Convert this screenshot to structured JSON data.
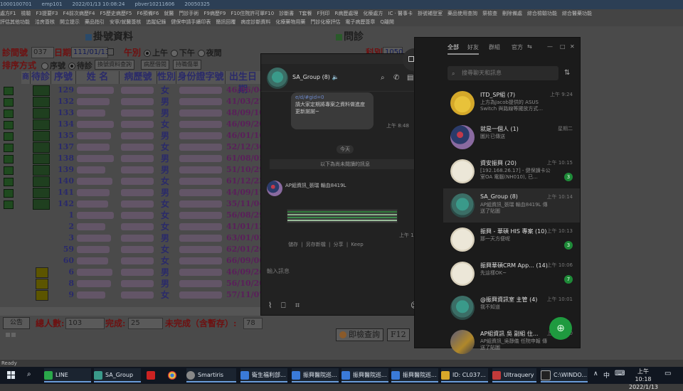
{
  "his": {
    "status_bar": [
      "1000100701",
      "emp101",
      "2022/01/13 10:08:24",
      "pbver10211606",
      "20050325"
    ],
    "menu_row1": [
      "處方F1",
      "檢驗",
      "F3提要F3",
      "F4前次病歷F4",
      "F5歷史病歷F5",
      "F6預備F6",
      "就醫",
      "門診手術",
      "F9病歷F9",
      "F10住院許可單F10",
      "診斷書",
      "T套餐",
      "F列印",
      "R病歷處理",
      "化療處方",
      "IC · 醫事卡",
      "掛號補登室",
      "藥品使用查詢",
      "祭檢查",
      "刪除備處",
      "綜合檢驗功能",
      "綜合醫藥功能"
    ],
    "menu_row2": [
      "評估其他功能",
      "洽房簽核",
      "開立提示",
      "藥品指引",
      "安寧/就醫簽核",
      "追蹤紀錄",
      "健保申請手續印表",
      "簡訊回覆",
      "病症診斷資料",
      "化療藥物用藥",
      "門診化療評估",
      "電子病歷簽章",
      "Q離開"
    ],
    "panel_title": "掛號資料",
    "panel_title2": "問診",
    "clinic_label": "診間號",
    "clinic_value": "037",
    "date_label": "日期",
    "date_value": "111/01/13",
    "shift_label": "午別",
    "shift_options": [
      "上午",
      "下午",
      "夜間"
    ],
    "sort_label": "排序方式",
    "sort_options": [
      "序號",
      "待診"
    ],
    "btn_search_patient": "換號資料查詢",
    "btn_history": "病歷借閱",
    "btn_ward": "持職傷單",
    "right_label_1": "科別",
    "right_value_1": "1050",
    "columns": [
      "商",
      "待診",
      "序號",
      "姓 名",
      "病歷號",
      "性別",
      "身份證字號",
      "出生日期"
    ],
    "rows": [
      {
        "no": "129",
        "sex": "女",
        "birth": "46/06/04",
        "status": "green"
      },
      {
        "no": "132",
        "sex": "男",
        "birth": "41/03/27",
        "status": "green"
      },
      {
        "no": "133",
        "sex": "男",
        "birth": "48/09/10",
        "status": "green"
      },
      {
        "no": "134",
        "sex": "女",
        "birth": "46/09/20",
        "status": "green"
      },
      {
        "no": "135",
        "sex": "男",
        "birth": "46/01/16",
        "status": "green"
      },
      {
        "no": "137",
        "sex": "女",
        "birth": "52/12/30",
        "status": "green"
      },
      {
        "no": "138",
        "sex": "男",
        "birth": "61/08/05",
        "status": "green"
      },
      {
        "no": "139",
        "sex": "男",
        "birth": "51/10/29",
        "status": "green"
      },
      {
        "no": "140",
        "sex": "女",
        "birth": "61/12/22",
        "status": "green"
      },
      {
        "no": "141",
        "sex": "男",
        "birth": "44/09/17",
        "status": "green"
      },
      {
        "no": "142",
        "sex": "女",
        "birth": "35/11/04",
        "status": "green"
      },
      {
        "no": "1",
        "sex": "女",
        "birth": "56/08/29",
        "status": "none"
      },
      {
        "no": "2",
        "sex": "女",
        "birth": "41/01/12",
        "status": "none"
      },
      {
        "no": "3",
        "sex": "男",
        "birth": "63/01/03",
        "status": "none"
      },
      {
        "no": "59",
        "sex": "女",
        "birth": "62/01/26",
        "status": "none"
      },
      {
        "no": "60",
        "sex": "女",
        "birth": "66/09/06",
        "status": "none"
      },
      {
        "no": "6",
        "sex": "男",
        "birth": "46/09/26",
        "status": "yellow"
      },
      {
        "no": "8",
        "sex": "男",
        "birth": "56/10/20",
        "status": "yellow"
      },
      {
        "no": "9",
        "sex": "女",
        "birth": "57/11/07",
        "status": "yellow"
      }
    ],
    "tab_label": "公告",
    "total_label": "總人數:",
    "total_value": "103",
    "done_label": "完成:",
    "done_value": "25",
    "undone_label": "未完成（含暫存）:",
    "undone_value": "78",
    "btn_query": "即檢查詢",
    "btn_f12": "F12",
    "status_text": "Ready"
  },
  "chat": {
    "group_name": "SA_Group (8)",
    "msg_link": "e/d/#gid=0",
    "msg_text": "請大家定期將專案之資料做進度更新謝謝~",
    "msg_time1": "上午 8:48",
    "day_label": "今天",
    "unread_label": "以下為尚未閱讀的訊息",
    "sender": "AP組資訊_張瑞 輸血8419L",
    "msg_time2": "上午 10:14",
    "msg_actions": "儲存 | 另存新檔 | 分享 | Keep",
    "input_placeholder": "輸入訊息",
    "header_icons": [
      "search-icon",
      "phone-icon",
      "note-icon",
      "more-icon"
    ],
    "toolbar_icons": [
      "attach-icon",
      "bookmark-icon",
      "crop-icon",
      "emoji-icon"
    ]
  },
  "line_main": {
    "tabs": [
      "全部",
      "好友",
      "群組",
      "官方"
    ],
    "search_placeholder": "搜尋聊天和訊息",
    "chats": [
      {
        "name": "ITD_SP組 (7)",
        "preview": "上方為Jacob提供的 ASUS Switch 與路線等擺放方式...",
        "time": "上午 9:24",
        "badge": "",
        "avatar": "yellow"
      },
      {
        "name": "就是一個人 (1)",
        "preview": "圖片已傳送",
        "time": "星期二",
        "badge": "",
        "avatar": "sky"
      },
      {
        "name": "資安振興 (20)",
        "preview": "[192.168.26.17] - 健保讀卡公室OA 電腦(NH010), 已...",
        "time": "上午 10:15",
        "badge": "3",
        "avatar": "dots"
      },
      {
        "name": "SA_Group (8)",
        "preview": "AP組資訊_張瑞 輸血8419L 傳送了貼圖",
        "time": "上午 10:14",
        "badge": "",
        "avatar": "teal"
      },
      {
        "name": "振興 - 華碩 HIS 專案 (10)",
        "preview": "那一天方便呢",
        "time": "上午 10:13",
        "badge": "3",
        "avatar": "dots"
      },
      {
        "name": "振興華碩CRM App... (14)",
        "preview": "先這樣OK~",
        "time": "上午 10:06",
        "badge": "7",
        "avatar": "dots"
      },
      {
        "name": "@振興資訊室 主管 (4)",
        "preview": "我不知道",
        "time": "上午 10:01",
        "badge": "",
        "avatar": "teal"
      },
      {
        "name": "AP組資訊 吳 副組 住...",
        "preview": "AP組資訊_吳靜儀 任院申報 傳送了貼圖",
        "time": "上午 10:00",
        "badge": "",
        "avatar": "photo"
      }
    ]
  },
  "taskbar": {
    "items": [
      "LINE",
      "SA_Group",
      "Smartiris",
      "衛生福利部...",
      "振興醫院巡...",
      "振興醫院巡...",
      "振興醫院巡...",
      "ID: CL037...",
      "Ultraquery",
      "C:\\WINDO..."
    ],
    "tray_ime": "中",
    "time": "上午 10:18",
    "date": "2022/1/13"
  }
}
